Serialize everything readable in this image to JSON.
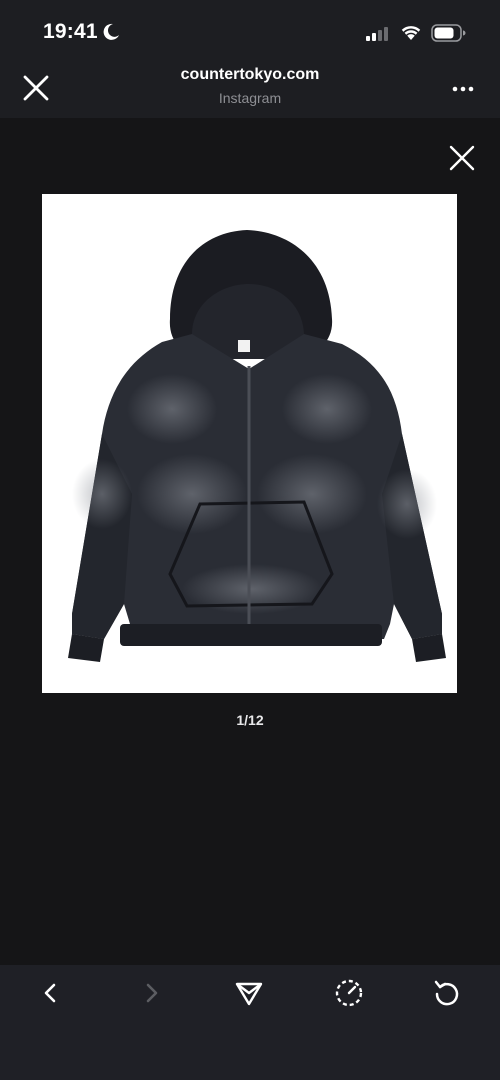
{
  "status_bar": {
    "time": "19:41",
    "icons": [
      "moon-icon",
      "cellular-signal-icon",
      "wifi-icon",
      "battery-icon"
    ]
  },
  "browser_header": {
    "site_title": "countertokyo.com",
    "subtitle": "Instagram",
    "icons": [
      "close-icon",
      "more-options-icon"
    ]
  },
  "viewer": {
    "image_subject": "black zip-up hoodie with faded wash",
    "counter": "1/12",
    "icons": [
      "close-icon"
    ]
  },
  "toolbar": {
    "icons": [
      "back-icon",
      "forward-icon",
      "share-icon",
      "speed-icon",
      "reload-icon"
    ],
    "forward_disabled": true
  },
  "colors": {
    "background": "#151517",
    "header": "#1d1e22",
    "toolbar": "#1f2026",
    "text_primary": "#ffffff",
    "text_secondary": "#8e8f94",
    "icon_disabled": "#5c5d62"
  }
}
